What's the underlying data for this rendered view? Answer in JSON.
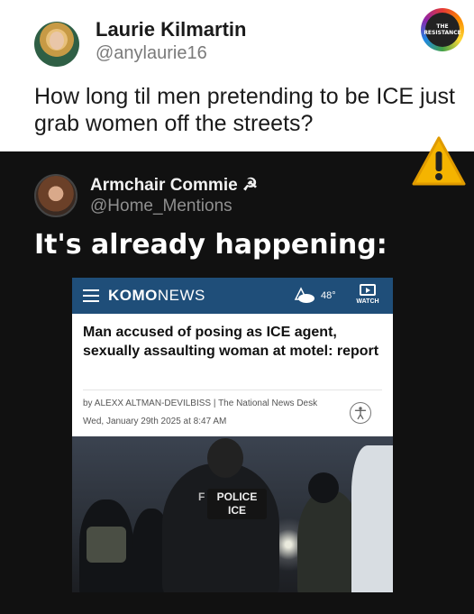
{
  "top_tweet": {
    "name": "Laurie Kilmartin",
    "handle": "@anylaurie16",
    "text": "How long til men pretending to be ICE just grab women off the streets?",
    "badge_text": "THE RESISTANCE"
  },
  "quote_tweet": {
    "name": "Armchair Commie ☭",
    "handle": "@Home_Mentions",
    "text": "It's already happening:"
  },
  "news_card": {
    "brand_bold": "KOMO",
    "brand_rest": "NEWS",
    "temperature": "48°",
    "watch_label": "WATCH",
    "headline": "Man accused of posing as ICE agent, sexually assaulting woman at motel: report",
    "byline": "by ALEXX ALTMAN-DEVILBISS | The National News Desk",
    "date": "Wed, January 29th 2025 at 8:47 AM",
    "photo": {
      "vest_line1": "POLICE",
      "vest_line2": "ICE",
      "vest_prefix": "F"
    }
  },
  "colors": {
    "komo_bar": "#1f4e79",
    "background_dark": "#111111",
    "warning": "#f5b400"
  },
  "icons": [
    "hamburger-menu-icon",
    "weather-cloud-icon",
    "video-watch-icon",
    "accessibility-icon",
    "warning-icon"
  ]
}
